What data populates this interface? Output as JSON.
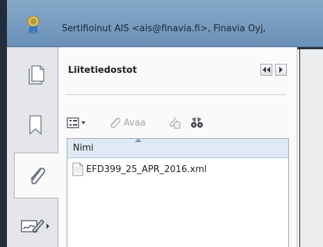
{
  "signature_bar": {
    "text": "Sertifioinut AIS <ais@finavia.fi>, Finavia Oyj,",
    "icon": "certificate-seal-icon"
  },
  "rail": {
    "buttons": [
      {
        "icon": "page-thumbnails-icon",
        "active": false
      },
      {
        "icon": "bookmark-icon",
        "active": false
      },
      {
        "icon": "paperclip-icon",
        "active": true
      },
      {
        "icon": "signature-pen-icon",
        "active": false
      }
    ]
  },
  "panel": {
    "title": "Liitetiedostot",
    "nav_back_icon": "double-chevron-left-icon",
    "nav_forward_icon": "chevron-right-icon",
    "toolbar": {
      "options_icon": "options-menu-icon",
      "open_label": "Avaa",
      "open_icon": "paperclip-open-icon",
      "add_icon": "add-attachment-icon",
      "search_icon": "binoculars-icon"
    },
    "list": {
      "column_header": "Nimi",
      "items": [
        {
          "name": "EFD399_25_APR_2016.xml",
          "icon": "file-icon"
        }
      ]
    }
  },
  "colors": {
    "signature_bar": "#7a9ec2",
    "panel_bg": "#fafafa",
    "rail_bg": "#e4e6ea",
    "header_bg": "#dfeaf6"
  }
}
